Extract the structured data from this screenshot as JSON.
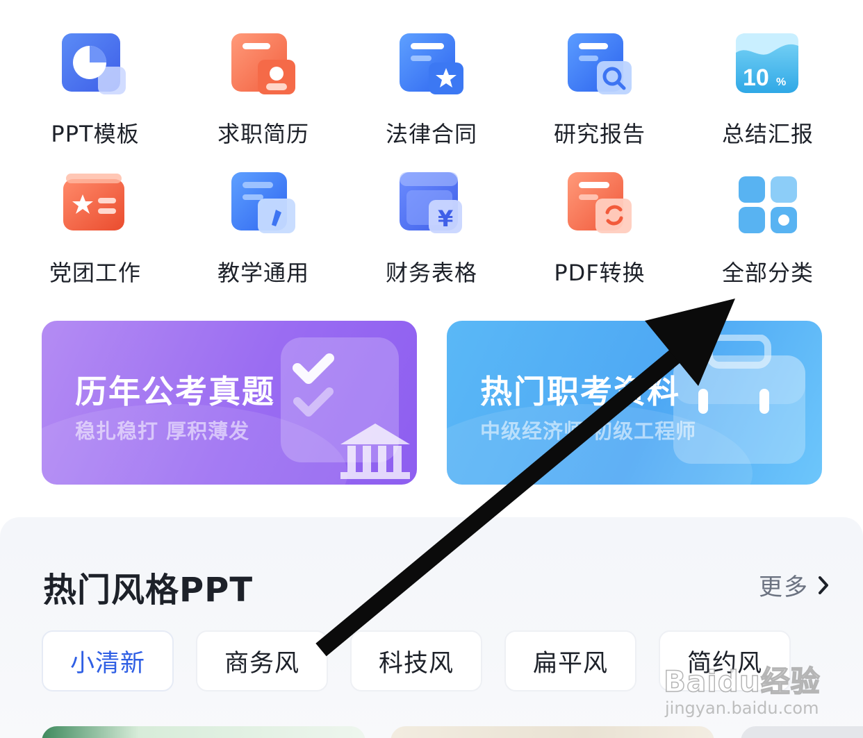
{
  "categories": [
    {
      "label": "PPT模板",
      "icon": "pie-chart-icon"
    },
    {
      "label": "求职简历",
      "icon": "resume-icon"
    },
    {
      "label": "法律合同",
      "icon": "contract-star-icon"
    },
    {
      "label": "研究报告",
      "icon": "report-search-icon"
    },
    {
      "label": "总结汇报",
      "icon": "chart-10-percent-icon",
      "badge": "10",
      "badge_unit": "%"
    },
    {
      "label": "党团工作",
      "icon": "party-star-card-icon"
    },
    {
      "label": "教学通用",
      "icon": "pencil-doc-icon"
    },
    {
      "label": "财务表格",
      "icon": "yen-doc-icon",
      "glyph": "¥"
    },
    {
      "label": "PDF转换",
      "icon": "pdf-convert-icon"
    },
    {
      "label": "全部分类",
      "icon": "all-categories-grid-icon"
    }
  ],
  "banners": [
    {
      "title": "历年公考真题",
      "subtitle": "稳扎稳打 厚积薄发",
      "icon": "checklist-building-icon",
      "color": "#9b6df2"
    },
    {
      "title": "热门职考资料",
      "subtitle": "中级经济师 初级工程师",
      "icon": "briefcase-icon",
      "color": "#4ea8f4"
    }
  ],
  "section": {
    "title": "热门风格PPT",
    "more_label": "更多",
    "chips": [
      "小清新",
      "商务风",
      "科技风",
      "扁平风",
      "简约风"
    ],
    "active_chip": "小清新"
  },
  "watermark": {
    "main": "Baidu经验",
    "sub": "jingyan.baidu.com"
  },
  "colors": {
    "accent": "#2f5fe4",
    "text": "#1d2129",
    "muted": "#6b7280"
  }
}
